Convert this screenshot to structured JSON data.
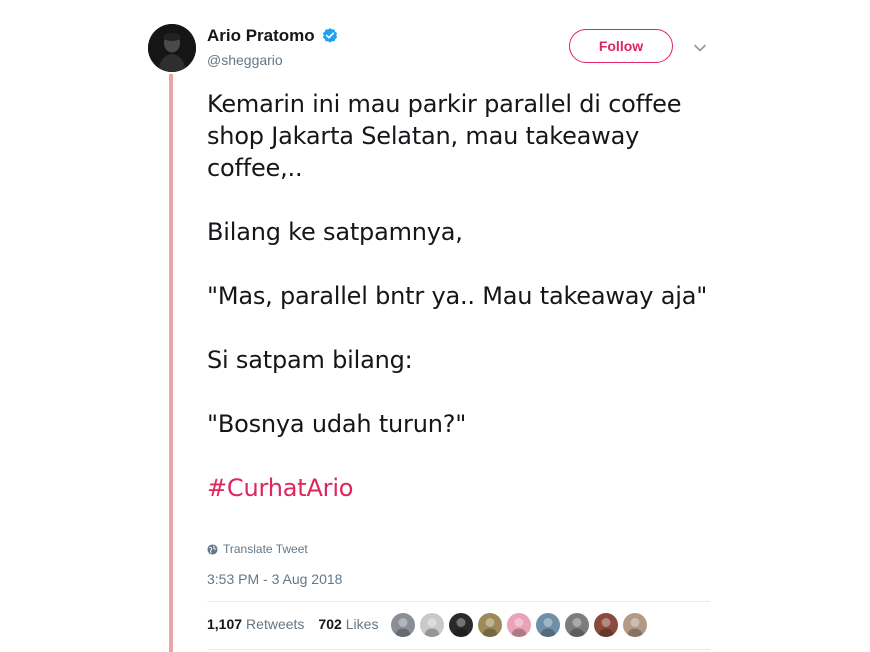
{
  "user": {
    "display_name": "Ario Pratomo",
    "handle": "@sheggario",
    "verified": true,
    "follow_label": "Follow"
  },
  "tweet": {
    "paragraphs": [
      "Kemarin ini mau parkir parallel di coffee shop Jakarta Selatan, mau takeaway coffee,..",
      "Bilang ke satpamnya,",
      "\"Mas, parallel bntr ya.. Mau takeaway aja\"",
      "Si satpam bilang:",
      "\"Bosnya udah turun?\""
    ],
    "hashtag": "#CurhatArio",
    "translate_label": "Translate Tweet",
    "timestamp": "3:53 PM - 3 Aug 2018"
  },
  "stats": {
    "retweets_count": "1,107",
    "retweets_label": "Retweets",
    "likes_count": "702",
    "likes_label": "Likes"
  },
  "likers": [
    {
      "color": "#8a8f96"
    },
    {
      "color": "#c9c9c9"
    },
    {
      "color": "#2a2a2a"
    },
    {
      "color": "#9c8a5a"
    },
    {
      "color": "#e9a3b8"
    },
    {
      "color": "#6f8fa6"
    },
    {
      "color": "#7d7d7d"
    },
    {
      "color": "#8a4b3c"
    },
    {
      "color": "#b39a85"
    }
  ],
  "colors": {
    "accent": "#e0245e",
    "thread_line": "#e8a6a9",
    "verified": "#1da1f2",
    "muted": "#657786"
  }
}
